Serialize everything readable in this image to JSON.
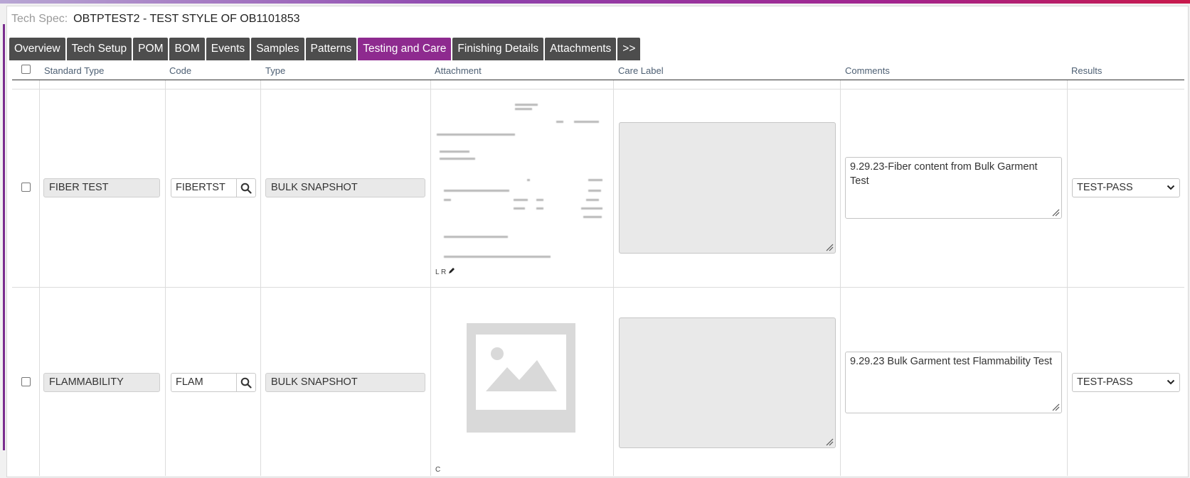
{
  "header": {
    "label": "Tech Spec:",
    "title": "OBTPTEST2 - TEST STYLE OF OB1101853"
  },
  "tabs": [
    {
      "label": "Overview",
      "active": false
    },
    {
      "label": "Tech Setup",
      "active": false
    },
    {
      "label": "POM",
      "active": false
    },
    {
      "label": "BOM",
      "active": false
    },
    {
      "label": "Events",
      "active": false
    },
    {
      "label": "Samples",
      "active": false
    },
    {
      "label": "Patterns",
      "active": false
    },
    {
      "label": "Testing and Care",
      "active": true
    },
    {
      "label": "Finishing Details",
      "active": false
    },
    {
      "label": "Attachments",
      "active": false
    },
    {
      "label": ">>",
      "active": false
    }
  ],
  "table": {
    "columns": [
      "Standard Type",
      "Code",
      "Type",
      "Attachment",
      "Care Label",
      "Comments",
      "Results"
    ],
    "rows": [
      {
        "standard_type": "FIBER TEST",
        "code": "FIBERTST",
        "type": "BULK SNAPSHOT",
        "attachment_caption": "L R",
        "comments": "9.29.23-Fiber content from Bulk Garment Test",
        "result": "TEST-PASS"
      },
      {
        "standard_type": "FLAMMABILITY",
        "code": "FLAM",
        "type": "BULK SNAPSHOT",
        "attachment_caption": "C",
        "comments": "9.29.23 Bulk Garment test Flammability Test",
        "result": "TEST-PASS"
      }
    ]
  },
  "icons": {
    "search": "search-icon",
    "select": "chevron-down-icon",
    "resize": "resize-grip-icon",
    "edit": "pencil-icon",
    "placeholder": "image-placeholder-icon"
  },
  "colors": {
    "active_tab": "#8e2a8f",
    "inactive_tab": "#4d4d4d",
    "header_text": "#4d5f73"
  }
}
